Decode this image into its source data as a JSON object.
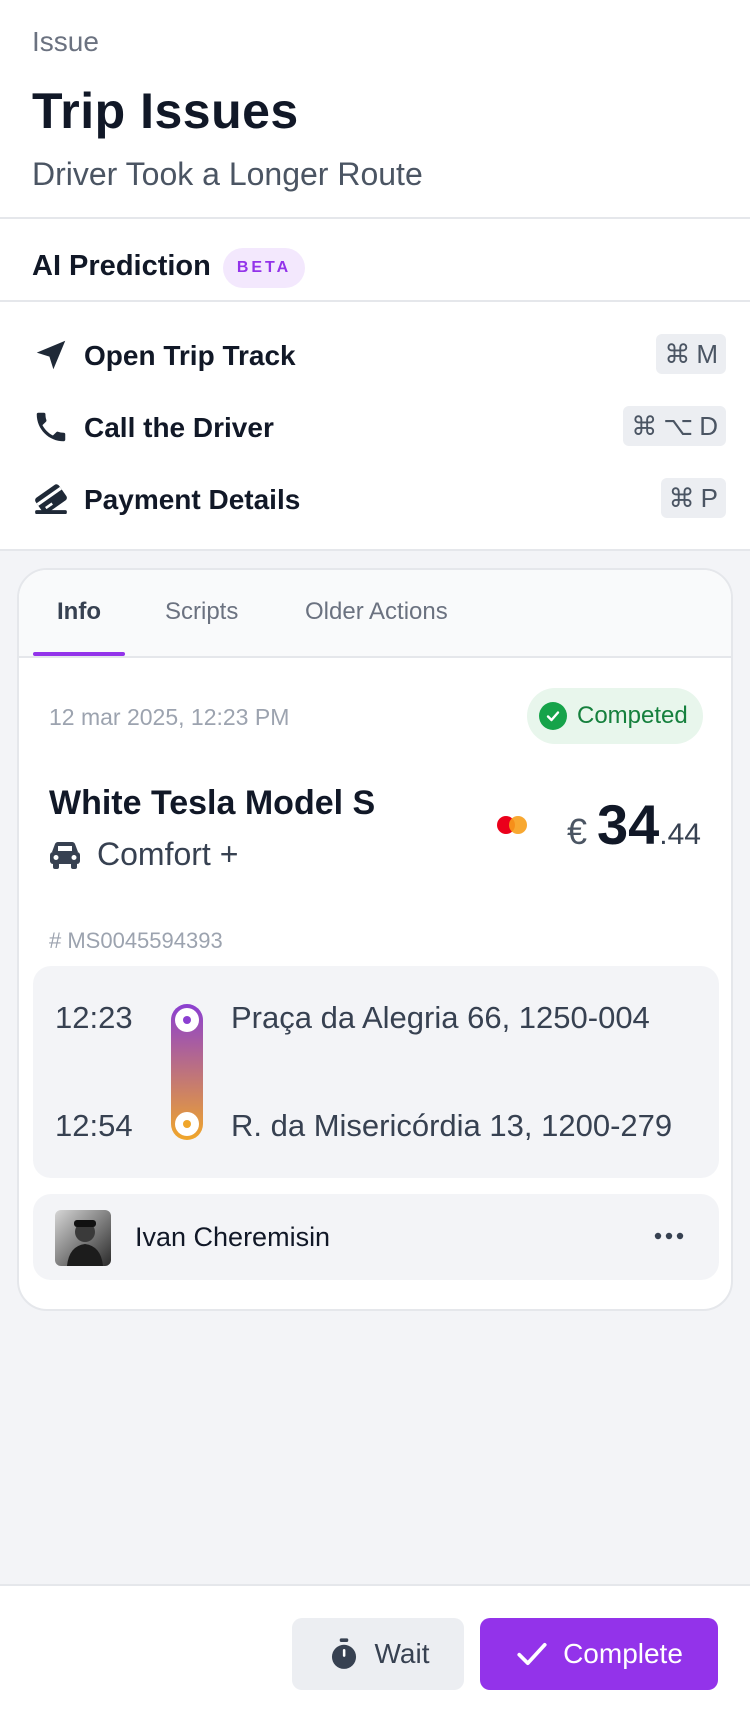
{
  "header": {
    "section_label": "Issue",
    "title": "Trip Issues",
    "subtitle": "Driver Took a Longer Route"
  },
  "ai_prediction": {
    "title": "AI Prediction",
    "badge": "BETA"
  },
  "actions": [
    {
      "label": "Open Trip Track",
      "icon": "navigation-arrow-icon",
      "shortcut": [
        "⌘",
        "M"
      ]
    },
    {
      "label": "Call the Driver",
      "icon": "phone-icon",
      "shortcut": [
        "⌘",
        "⌥",
        "D"
      ]
    },
    {
      "label": "Payment Details",
      "icon": "credit-card-icon",
      "shortcut": [
        "⌘",
        "P"
      ]
    }
  ],
  "tabs": [
    {
      "label": "Info",
      "active": true
    },
    {
      "label": "Scripts",
      "active": false
    },
    {
      "label": "Older Actions",
      "active": false
    }
  ],
  "trip": {
    "datetime": "12 mar 2025, 12:23 PM",
    "status": "Competed",
    "car_name": "White Tesla Model S",
    "car_class": "Comfort +",
    "price_currency": "€",
    "price_integer": "34",
    "price_decimal": ".44",
    "trip_id": "# MS0045594393",
    "route": {
      "start_time": "12:23",
      "start_address": "Praça da Alegria 66, 1250-004",
      "end_time": "12:54",
      "end_address": "R. da Misericórdia 13, 1200-279"
    },
    "driver_name": "Ivan Cheremisin"
  },
  "footer": {
    "wait_label": "Wait",
    "complete_label": "Complete"
  },
  "colors": {
    "accent": "#9333ea",
    "status_green": "#16a34a",
    "route_start": "#8b3fd1",
    "route_end": "#f0a62a"
  }
}
